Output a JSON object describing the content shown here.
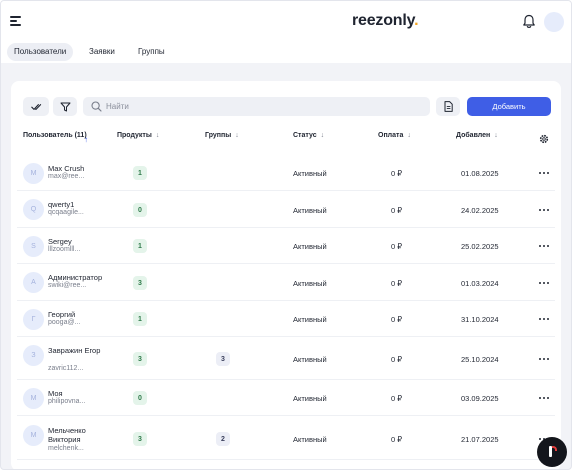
{
  "header": {
    "logo_text": "reezonly",
    "logo_dot": "."
  },
  "tabs": [
    {
      "label": "Пользователи",
      "active": true
    },
    {
      "label": "Заявки",
      "active": false
    },
    {
      "label": "Группы",
      "active": false
    }
  ],
  "toolbar": {
    "search_placeholder": "Найти",
    "add_label": "Добавить"
  },
  "table": {
    "columns": [
      {
        "label": "Пользователь (11)",
        "sort": "asc"
      },
      {
        "label": "Продукты",
        "sort": "desc"
      },
      {
        "label": "Группы",
        "sort": "desc"
      },
      {
        "label": "Статус",
        "sort": "desc"
      },
      {
        "label": "Оплата",
        "sort": "desc"
      },
      {
        "label": "Добавлен",
        "sort": "desc"
      }
    ],
    "rows": [
      {
        "initial": "M",
        "name": "Max Crush",
        "email": "max@ree...",
        "products": "1",
        "groups": "",
        "status": "Активный",
        "payment": "0 ₽",
        "added": "01.08.2025"
      },
      {
        "initial": "Q",
        "name": "qwerty1",
        "email": "qcqaagile...",
        "products": "0",
        "groups": "",
        "status": "Активный",
        "payment": "0 ₽",
        "added": "24.02.2025"
      },
      {
        "initial": "S",
        "name": "Sergey",
        "email": "lllzoomlll...",
        "products": "1",
        "groups": "",
        "status": "Активный",
        "payment": "0 ₽",
        "added": "25.02.2025"
      },
      {
        "initial": "А",
        "name": "Администратор",
        "email": "swiki@ree...",
        "products": "3",
        "groups": "",
        "status": "Активный",
        "payment": "0 ₽",
        "added": "01.03.2024"
      },
      {
        "initial": "Г",
        "name": "Георгий",
        "email": "pooga@...",
        "products": "1",
        "groups": "",
        "status": "Активный",
        "payment": "0 ₽",
        "added": "31.10.2024"
      },
      {
        "initial": "З",
        "name": "Завражин Егор",
        "email": "zavric112...",
        "products": "3",
        "groups": "3",
        "status": "Активный",
        "payment": "0 ₽",
        "added": "25.10.2024"
      },
      {
        "initial": "М",
        "name": "Моя",
        "email": "philipovna...",
        "products": "0",
        "groups": "",
        "status": "Активный",
        "payment": "0 ₽",
        "added": "03.09.2025"
      },
      {
        "initial": "М",
        "name": "Мельченко Виктория",
        "email": "melchenk...",
        "products": "3",
        "groups": "2",
        "status": "Активный",
        "payment": "0 ₽",
        "added": "21.07.2025"
      }
    ]
  },
  "colors": {
    "primary": "#3f5ee6",
    "logo_accent": "#f5a623",
    "badge_green_bg": "#e4f4ea",
    "page_bg": "#f2f3f7"
  },
  "icons": [
    "menu-icon",
    "bell-icon",
    "avatar",
    "check-double-icon",
    "filter-icon",
    "search-icon",
    "document-icon",
    "settings-icon",
    "more-icon",
    "help-icon"
  ]
}
